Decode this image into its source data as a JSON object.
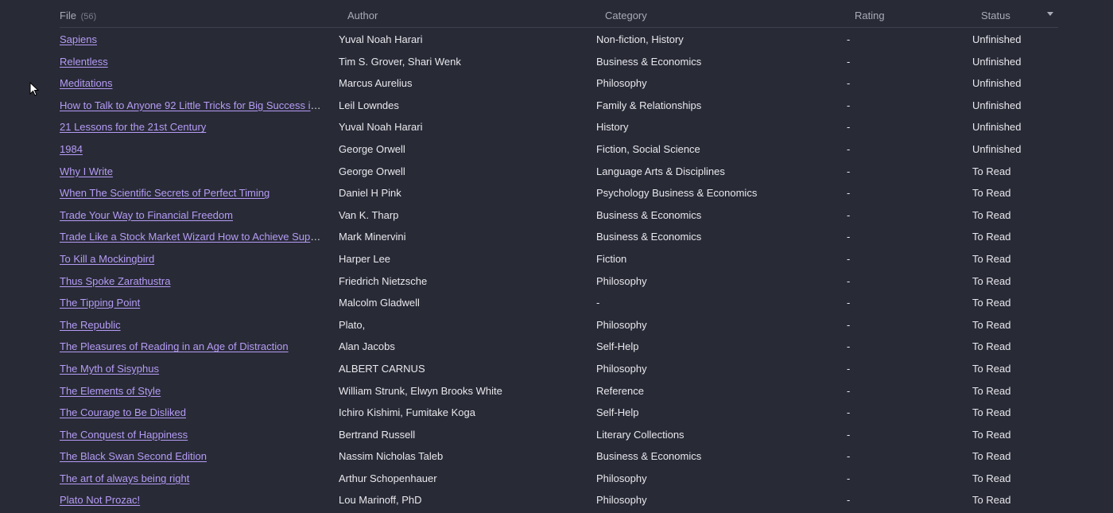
{
  "header": {
    "file_label": "File",
    "file_count": "(56)",
    "author_label": "Author",
    "category_label": "Category",
    "rating_label": "Rating",
    "status_label": "Status",
    "sort_icon": "chevron-down-icon"
  },
  "colors": {
    "background": "#282a36",
    "link": "#b59cf5",
    "text": "#e8e8ec",
    "header_text": "#a9abb5"
  },
  "rows": [
    {
      "file": "Sapiens",
      "author": "Yuval Noah Harari",
      "category": "Non-fiction, History",
      "rating": "-",
      "status": "Unfinished"
    },
    {
      "file": "Relentless",
      "author": "Tim S. Grover, Shari Wenk",
      "category": "Business & Economics",
      "rating": "-",
      "status": "Unfinished"
    },
    {
      "file": "Meditations",
      "author": "Marcus Aurelius",
      "category": "Philosophy",
      "rating": "-",
      "status": "Unfinished"
    },
    {
      "file": "How to Talk to Anyone 92 Little Tricks for Big Success in...",
      "author": "Leil Lowndes",
      "category": "Family & Relationships",
      "rating": "-",
      "status": "Unfinished"
    },
    {
      "file": "21 Lessons for the 21st Century",
      "author": "Yuval Noah Harari",
      "category": "History",
      "rating": "-",
      "status": "Unfinished"
    },
    {
      "file": "1984",
      "author": "George Orwell",
      "category": "Fiction, Social Science",
      "rating": "-",
      "status": "Unfinished"
    },
    {
      "file": "Why I Write",
      "author": "George Orwell",
      "category": "Language Arts & Disciplines",
      "rating": "-",
      "status": "To Read"
    },
    {
      "file": "When The Scientific Secrets of Perfect Timing",
      "author": "Daniel H Pink",
      "category": "Psychology Business & Economics",
      "rating": "-",
      "status": "To Read"
    },
    {
      "file": "Trade Your Way to Financial Freedom",
      "author": "Van K. Tharp",
      "category": "Business & Economics",
      "rating": "-",
      "status": "To Read"
    },
    {
      "file": "Trade Like a Stock Market Wizard How to Achieve Supe...",
      "author": "Mark Minervini",
      "category": "Business & Economics",
      "rating": "-",
      "status": "To Read"
    },
    {
      "file": "To Kill a Mockingbird",
      "author": "Harper Lee",
      "category": "Fiction",
      "rating": "-",
      "status": "To Read"
    },
    {
      "file": "Thus Spoke Zarathustra",
      "author": "Friedrich Nietzsche",
      "category": "Philosophy",
      "rating": "-",
      "status": "To Read"
    },
    {
      "file": "The Tipping Point",
      "author": "Malcolm Gladwell",
      "category": "-",
      "rating": "-",
      "status": "To Read"
    },
    {
      "file": "The Republic",
      "author": "Plato,",
      "category": "Philosophy",
      "rating": "-",
      "status": "To Read"
    },
    {
      "file": "The Pleasures of Reading in an Age of Distraction",
      "author": "Alan Jacobs",
      "category": "Self-Help",
      "rating": "-",
      "status": "To Read"
    },
    {
      "file": "The Myth of Sisyphus",
      "author": "ALBERT CARNUS",
      "category": "Philosophy",
      "rating": "-",
      "status": "To Read"
    },
    {
      "file": "The Elements of Style",
      "author": "William Strunk, Elwyn Brooks White",
      "category": "Reference",
      "rating": "-",
      "status": "To Read"
    },
    {
      "file": "The Courage to Be Disliked",
      "author": "Ichiro Kishimi, Fumitake Koga",
      "category": "Self-Help",
      "rating": "-",
      "status": "To Read"
    },
    {
      "file": "The Conquest of Happiness",
      "author": "Bertrand Russell",
      "category": "Literary Collections",
      "rating": "-",
      "status": "To Read"
    },
    {
      "file": "The Black Swan Second Edition",
      "author": "Nassim Nicholas Taleb",
      "category": "Business & Economics",
      "rating": "-",
      "status": "To Read"
    },
    {
      "file": "The art of always being right",
      "author": "Arthur Schopenhauer",
      "category": "Philosophy",
      "rating": "-",
      "status": "To Read"
    },
    {
      "file": "Plato Not Prozac!",
      "author": "Lou Marinoff, PhD",
      "category": "Philosophy",
      "rating": "-",
      "status": "To Read"
    }
  ]
}
